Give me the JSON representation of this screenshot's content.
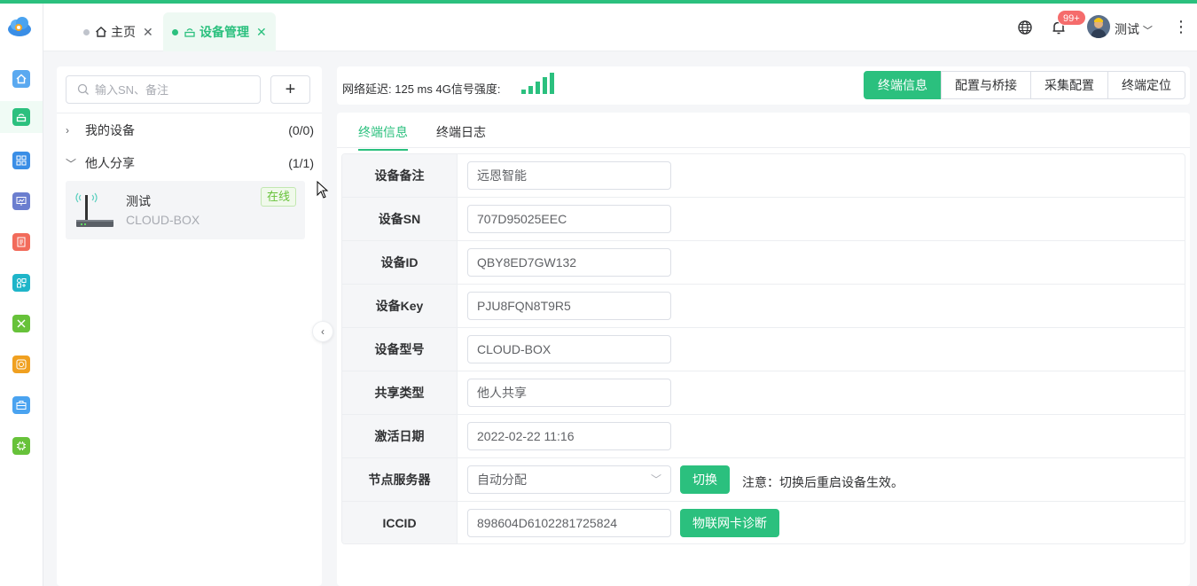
{
  "header": {
    "tabs": [
      {
        "label": "主页",
        "active": false
      },
      {
        "label": "设备管理",
        "active": true
      }
    ],
    "notification_badge": "99+",
    "user_name": "测试"
  },
  "rail": {
    "items": [
      "home",
      "device",
      "apps",
      "monitor",
      "report",
      "config",
      "tools",
      "chip",
      "package",
      "processor"
    ]
  },
  "list": {
    "search_placeholder": "输入SN、备注",
    "groups": [
      {
        "label": "我的设备",
        "count": "(0/0)",
        "expanded": false
      },
      {
        "label": "他人分享",
        "count": "(1/1)",
        "expanded": true
      }
    ],
    "device": {
      "name": "测试",
      "model": "CLOUD-BOX",
      "status": "在线"
    }
  },
  "statusbar": {
    "latency_label": "网络延迟:",
    "latency_value": "125 ms",
    "signal_label": "4G信号强度:",
    "signal_bars": 5,
    "buttons": [
      "终端信息",
      "配置与桥接",
      "采集配置",
      "终端定位"
    ]
  },
  "subtabs": [
    "终端信息",
    "终端日志"
  ],
  "form": {
    "rows": [
      {
        "label": "设备备注",
        "value": "远恩智能"
      },
      {
        "label": "设备SN",
        "value": "707D95025EEC"
      },
      {
        "label": "设备ID",
        "value": "QBY8ED7GW132"
      },
      {
        "label": "设备Key",
        "value": "PJU8FQN8T9R5"
      },
      {
        "label": "设备型号",
        "value": "CLOUD-BOX"
      },
      {
        "label": "共享类型",
        "value": "他人共享"
      },
      {
        "label": "激活日期",
        "value": "2022-02-22 11:16"
      },
      {
        "label": "节点服务器",
        "value": "自动分配"
      },
      {
        "label": "ICCID",
        "value": "898604D6102281725824"
      }
    ],
    "switch_button": "切换",
    "switch_note": "注意：切换后重启设备生效。",
    "diagnose_button": "物联网卡诊断"
  },
  "colors": {
    "accent": "#2bc07e",
    "badge": "#f56c6c",
    "online": "#67c23a"
  }
}
